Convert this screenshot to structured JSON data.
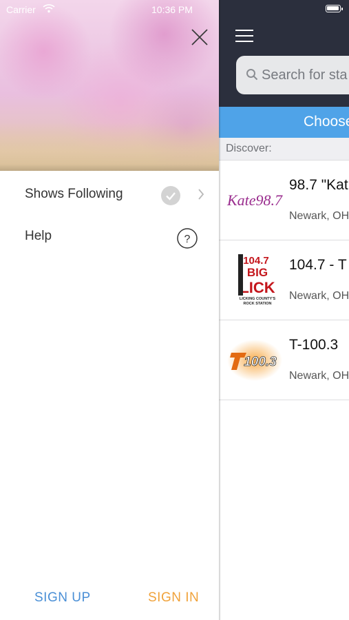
{
  "status_bar": {
    "carrier": "Carrier",
    "time": "10:36 PM"
  },
  "drawer": {
    "items": [
      {
        "label": "Shows Following",
        "icon": "check-circle-icon"
      },
      {
        "label": "Help",
        "icon": "question-circle-icon"
      }
    ],
    "sign_up_label": "SIGN UP",
    "sign_in_label": "SIGN IN",
    "colors": {
      "sign_up": "#4a8fd6",
      "sign_in": "#f0a23a"
    }
  },
  "main": {
    "search_placeholder": "Search for sta",
    "choose_label": "Choose",
    "section_label": "Discover:",
    "stations": [
      {
        "name": "98.7 \"Kat",
        "location": "Newark, OH",
        "logo_text": "Kate98.7"
      },
      {
        "name": "104.7 - T",
        "location": "Newark, OH",
        "logo_text": "104.7 THE BIG LICK LICKING COUNTY'S ROCK STATION"
      },
      {
        "name": "T-100.3",
        "location": "Newark, OH",
        "logo_text": "T100.3"
      }
    ],
    "colors": {
      "header": "#2b2f3d",
      "choose_bar": "#4fa3e8"
    }
  }
}
